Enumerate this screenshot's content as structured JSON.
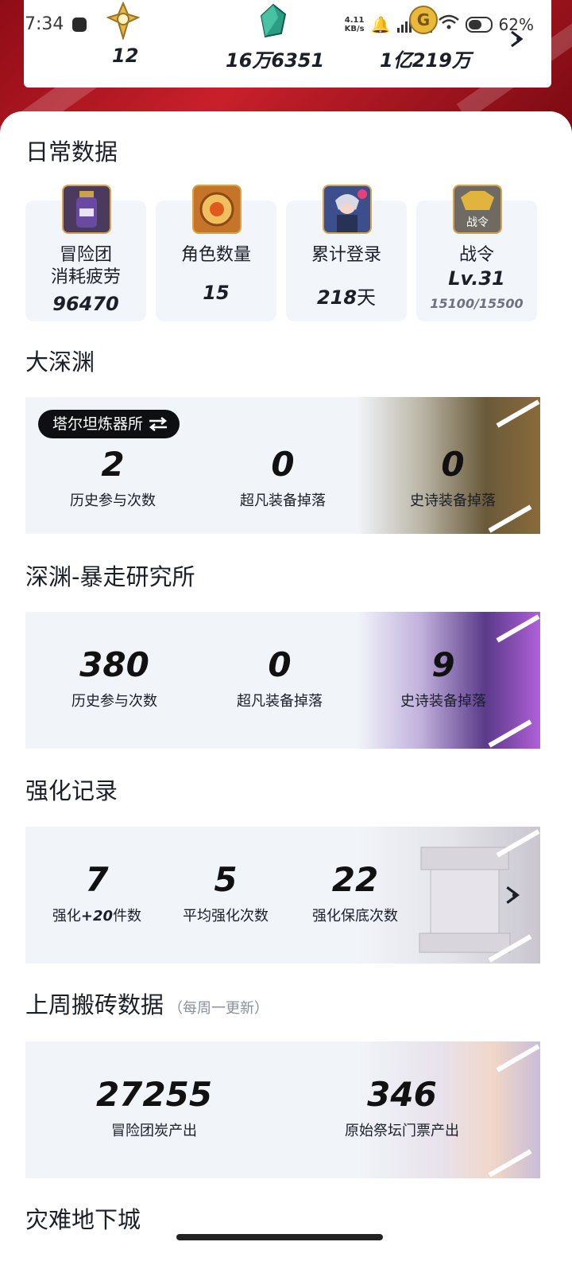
{
  "status_bar": {
    "time": "7:34",
    "speed_top": "4.11",
    "speed_unit": "KB/s",
    "battery": "62%"
  },
  "currencies": [
    {
      "icon": "gold-emblem-icon",
      "value": "12"
    },
    {
      "icon": "green-crystal-icon",
      "value": "16万6351"
    },
    {
      "icon": "gold-coin-icon",
      "value": "1亿219万"
    }
  ],
  "daily": {
    "title": "日常数据",
    "items": [
      {
        "icon": "fatigue-potion-icon",
        "label_line1": "冒险团",
        "label_line2": "消耗疲劳",
        "value": "96470"
      },
      {
        "icon": "character-medal-icon",
        "label_line1": "角色数量",
        "value": "15"
      },
      {
        "icon": "login-character-icon",
        "label_line1": "累计登录",
        "value_num": "218",
        "value_unit": "天"
      },
      {
        "icon": "battle-pass-icon",
        "icon_text": "战令",
        "label_line1": "战令",
        "value": "Lv.31",
        "sub": "15100/15500"
      }
    ]
  },
  "abyss": {
    "title": "大深渊",
    "selector": "塔尔坦炼器所",
    "stats": [
      {
        "value": "2",
        "label": "历史参与次数"
      },
      {
        "value": "0",
        "label": "超凡装备掉落"
      },
      {
        "value": "0",
        "label": "史诗装备掉落"
      }
    ]
  },
  "rampage": {
    "title": "深渊-暴走研究所",
    "stats": [
      {
        "value": "380",
        "label": "历史参与次数"
      },
      {
        "value": "0",
        "label": "超凡装备掉落"
      },
      {
        "value": "9",
        "label": "史诗装备掉落"
      }
    ]
  },
  "enhance": {
    "title": "强化记录",
    "stats": [
      {
        "value": "7",
        "label_prefix": "强化",
        "label_bold": "+20",
        "label_suffix": "件数"
      },
      {
        "value": "5",
        "label": "平均强化次数"
      },
      {
        "value": "22",
        "label": "强化保底次数"
      }
    ]
  },
  "weekly": {
    "title": "上周搬砖数据",
    "note": "（每周一更新）",
    "stats": [
      {
        "value": "27255",
        "label": "冒险团炭产出"
      },
      {
        "value": "346",
        "label": "原始祭坛门票产出"
      }
    ]
  },
  "calamity": {
    "title": "灾难地下城"
  }
}
